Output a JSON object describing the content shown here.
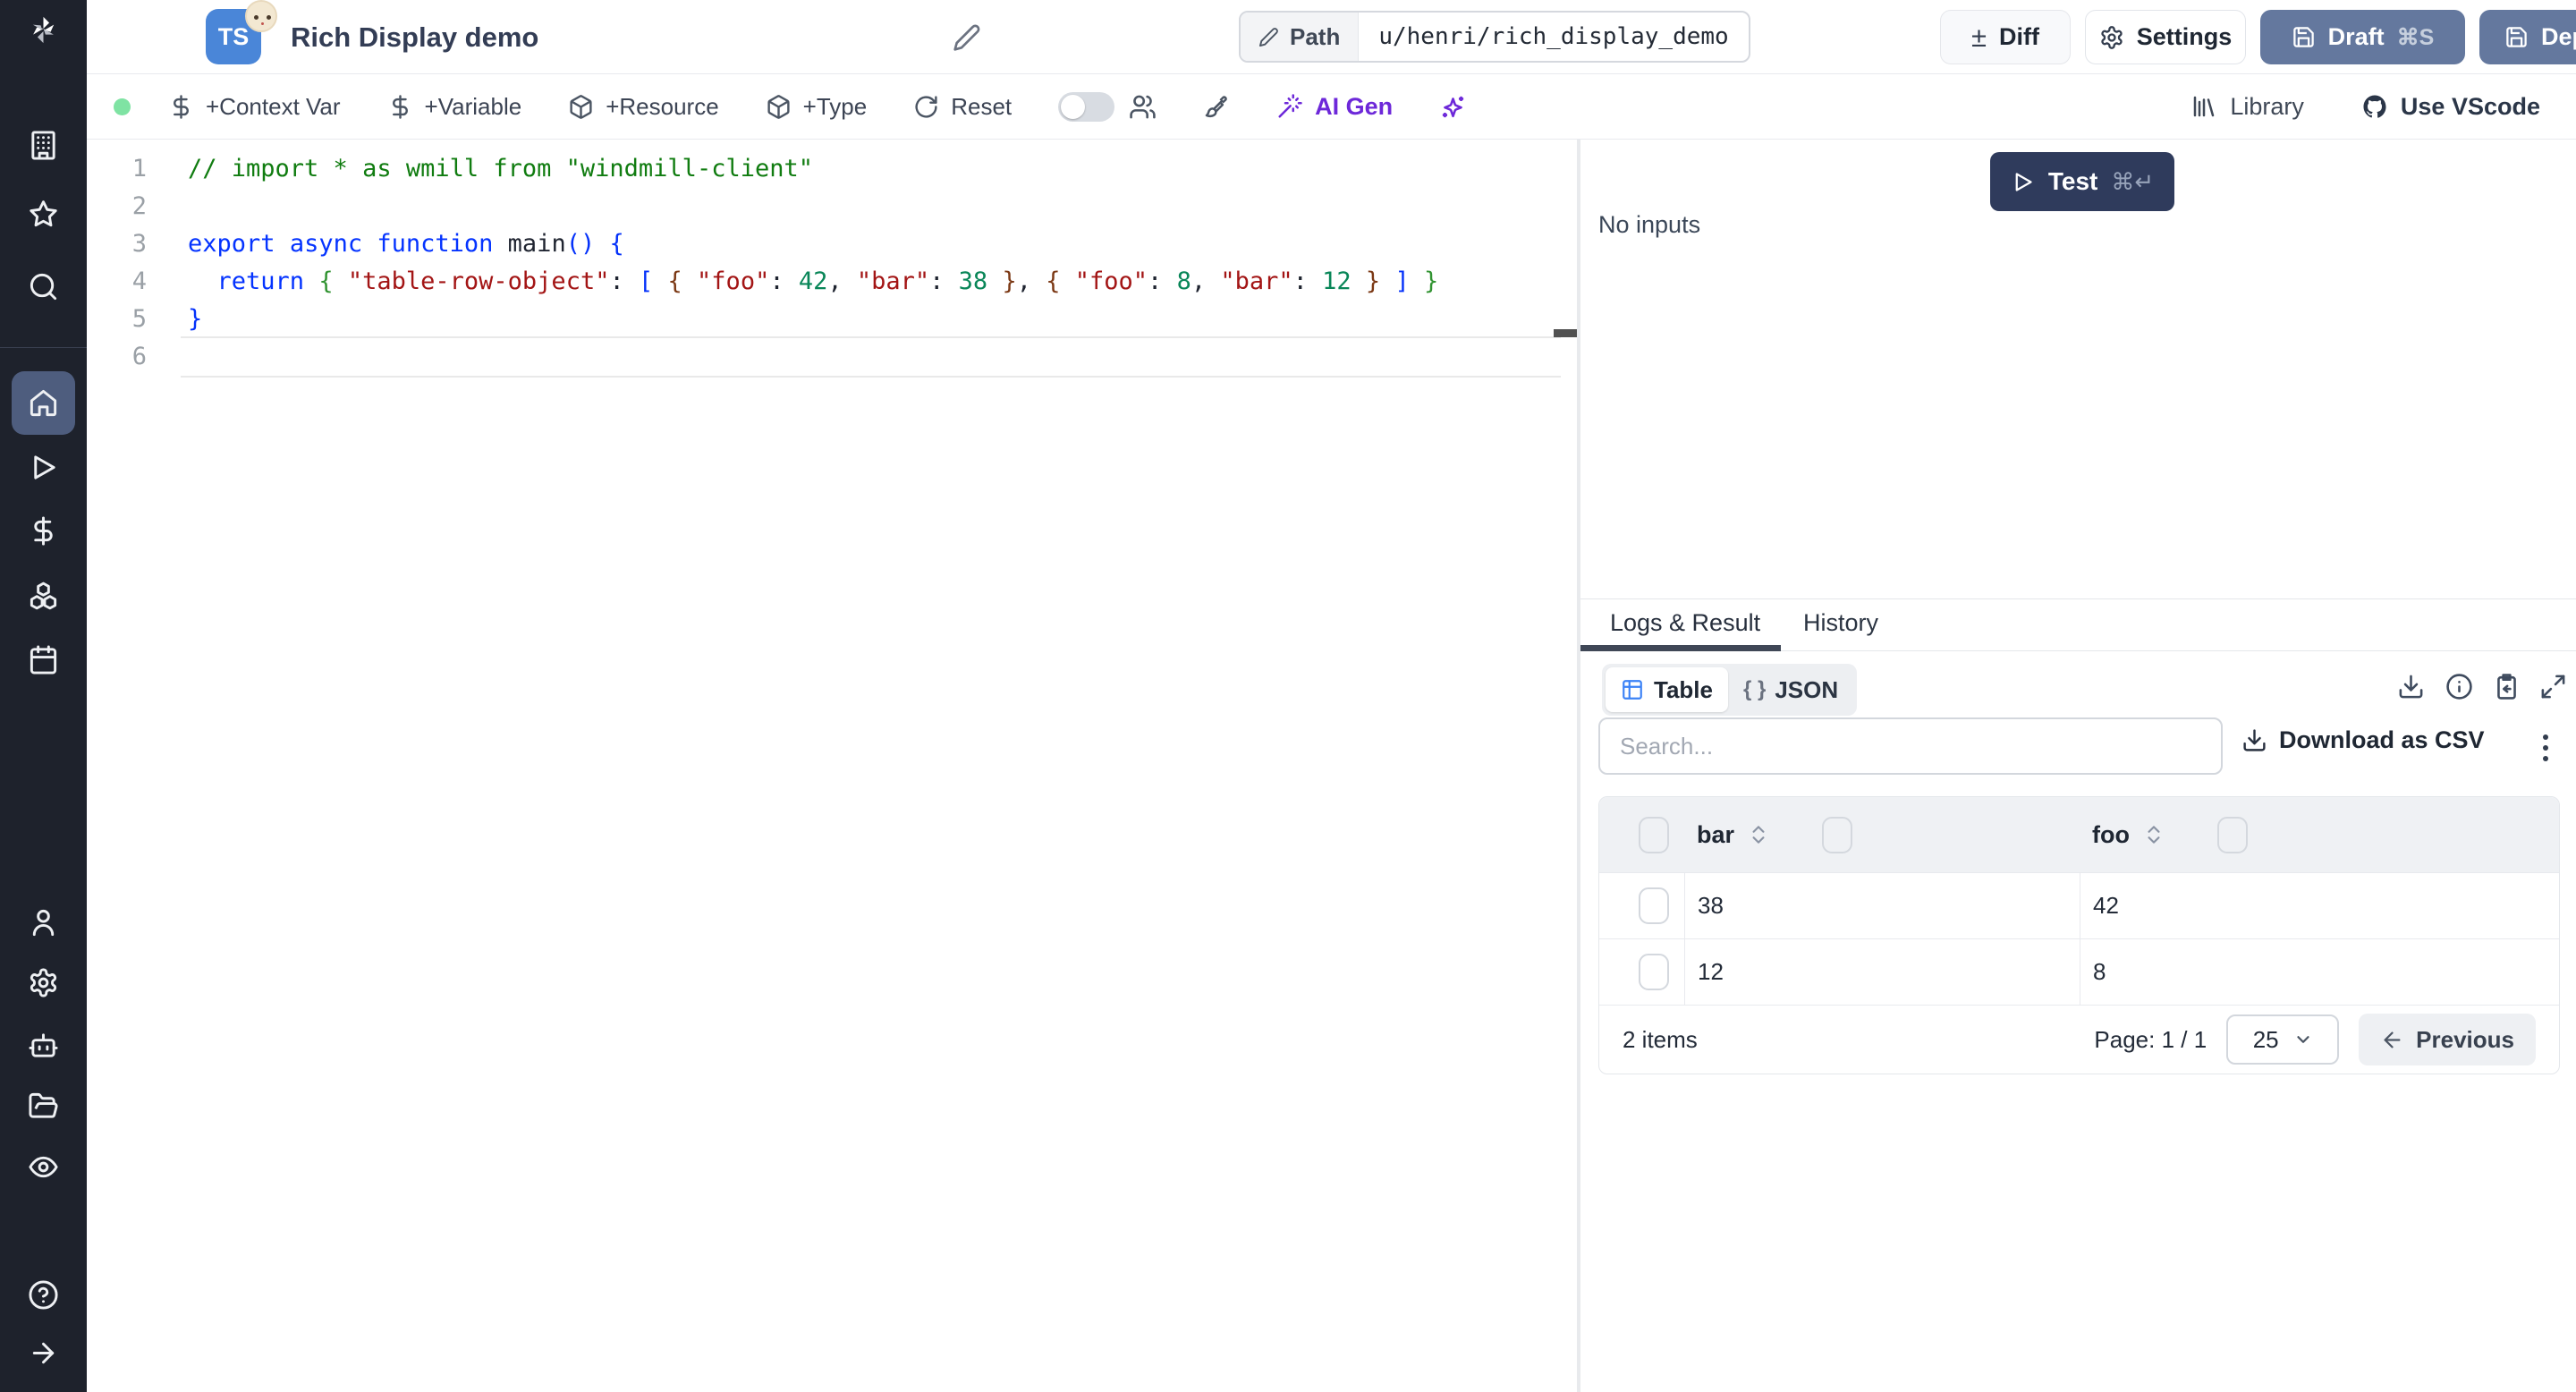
{
  "colors": {
    "accent_slate": "#64789e",
    "test_navy": "#2f3b5c",
    "ai_purple": "#6d28d9",
    "green_dot": "#7fe3a3",
    "ts_blue": "#4a86d8"
  },
  "header": {
    "language_badge": "TS",
    "title": "Rich Display demo",
    "path_label": "Path",
    "path_value": "u/henri/rich_display_demo",
    "diff_label": "Diff",
    "settings_label": "Settings",
    "draft_label": "Draft",
    "draft_shortcut": "⌘S",
    "deploy_label": "Deploy"
  },
  "toolbar": {
    "context_var": "+Context Var",
    "variable": "+Variable",
    "resource": "+Resource",
    "type": "+Type",
    "reset": "Reset",
    "ai_gen": "AI Gen",
    "library": "Library",
    "use_vscode": "Use VScode"
  },
  "editor": {
    "lines": [
      {
        "num": "1",
        "tokens": [
          {
            "t": "// import * as wmill from \"windmill-client\"",
            "c": "comment"
          }
        ]
      },
      {
        "num": "2",
        "tokens": []
      },
      {
        "num": "3",
        "tokens": [
          {
            "t": "export",
            "c": "kw"
          },
          {
            "t": " ",
            "c": "plain"
          },
          {
            "t": "async",
            "c": "kw"
          },
          {
            "t": " ",
            "c": "plain"
          },
          {
            "t": "function",
            "c": "kw"
          },
          {
            "t": " ",
            "c": "plain"
          },
          {
            "t": "main",
            "c": "fn"
          },
          {
            "t": "()",
            "c": "br1"
          },
          {
            "t": " ",
            "c": "plain"
          },
          {
            "t": "{",
            "c": "br1"
          }
        ]
      },
      {
        "num": "4",
        "tokens": [
          {
            "t": "  ",
            "c": "plain"
          },
          {
            "t": "return",
            "c": "kw"
          },
          {
            "t": " ",
            "c": "plain"
          },
          {
            "t": "{",
            "c": "br2"
          },
          {
            "t": " ",
            "c": "plain"
          },
          {
            "t": "\"table-row-object\"",
            "c": "string"
          },
          {
            "t": ": ",
            "c": "plain"
          },
          {
            "t": "[",
            "c": "br1"
          },
          {
            "t": " ",
            "c": "plain"
          },
          {
            "t": "{",
            "c": "br3"
          },
          {
            "t": " ",
            "c": "plain"
          },
          {
            "t": "\"foo\"",
            "c": "string"
          },
          {
            "t": ": ",
            "c": "plain"
          },
          {
            "t": "42",
            "c": "num"
          },
          {
            "t": ", ",
            "c": "plain"
          },
          {
            "t": "\"bar\"",
            "c": "string"
          },
          {
            "t": ": ",
            "c": "plain"
          },
          {
            "t": "38",
            "c": "num"
          },
          {
            "t": " ",
            "c": "plain"
          },
          {
            "t": "}",
            "c": "br3"
          },
          {
            "t": ", ",
            "c": "plain"
          },
          {
            "t": "{",
            "c": "br3"
          },
          {
            "t": " ",
            "c": "plain"
          },
          {
            "t": "\"foo\"",
            "c": "string"
          },
          {
            "t": ": ",
            "c": "plain"
          },
          {
            "t": "8",
            "c": "num"
          },
          {
            "t": ", ",
            "c": "plain"
          },
          {
            "t": "\"bar\"",
            "c": "string"
          },
          {
            "t": ": ",
            "c": "plain"
          },
          {
            "t": "12",
            "c": "num"
          },
          {
            "t": " ",
            "c": "plain"
          },
          {
            "t": "}",
            "c": "br3"
          },
          {
            "t": " ",
            "c": "plain"
          },
          {
            "t": "]",
            "c": "br1"
          },
          {
            "t": " ",
            "c": "plain"
          },
          {
            "t": "}",
            "c": "br2"
          }
        ]
      },
      {
        "num": "5",
        "tokens": [
          {
            "t": "}",
            "c": "br1"
          }
        ]
      },
      {
        "num": "6",
        "tokens": [],
        "current": true
      }
    ]
  },
  "run_panel": {
    "test_label": "Test",
    "test_shortcut": "⌘↵",
    "no_inputs": "No inputs"
  },
  "result_panel": {
    "tabs": [
      {
        "label": "Logs & Result",
        "active": true
      },
      {
        "label": "History",
        "active": false
      }
    ],
    "view_toggle": [
      {
        "label": "Table",
        "active": true
      },
      {
        "label": "JSON",
        "active": false
      }
    ],
    "json_icon": "{ }",
    "search_placeholder": "Search...",
    "download_csv": "Download as CSV",
    "table": {
      "columns": [
        "bar",
        "foo"
      ],
      "rows": [
        [
          "38",
          "42"
        ],
        [
          "12",
          "8"
        ]
      ],
      "items_count": "2 items",
      "page_label": "Page: 1 / 1",
      "page_size": "25",
      "previous": "Previous"
    }
  }
}
